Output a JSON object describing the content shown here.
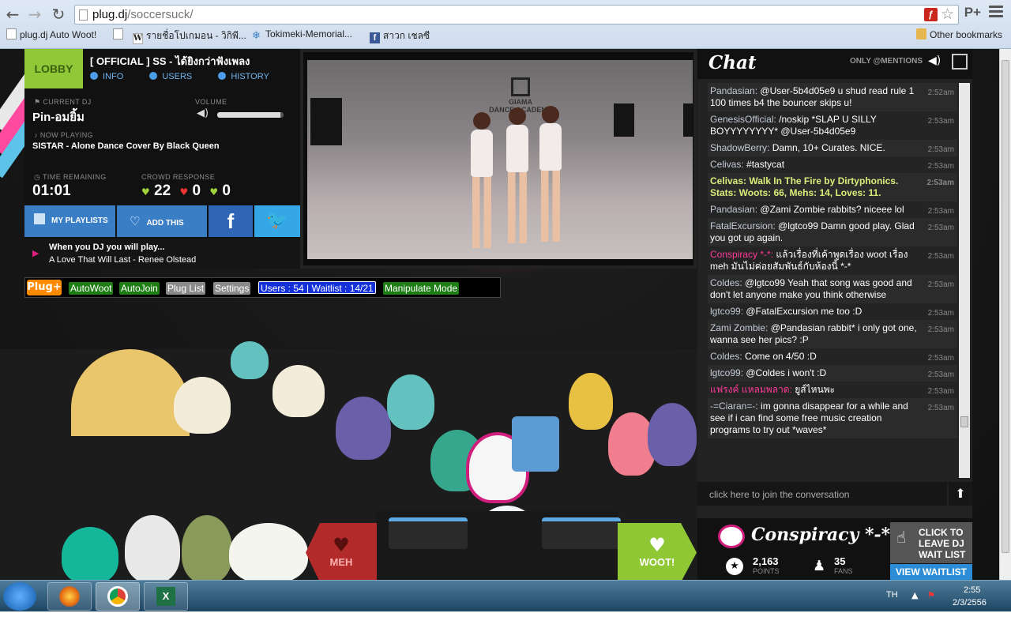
{
  "browser": {
    "url_host": "plug.dj",
    "url_path": "/soccersuck/",
    "bookmarks": [
      {
        "label": "plug.dj Auto Woot!",
        "icon": "page-icon"
      },
      {
        "label": "",
        "icon": "page-icon"
      },
      {
        "label": "รายชื่อโปเกมอน - วิกิพี...",
        "icon": "wikipedia-icon"
      },
      {
        "label": "Tokimeki-Memorial...",
        "icon": "snowflake-icon"
      },
      {
        "label": "สาวก เชลซี",
        "icon": "facebook-icon"
      }
    ],
    "other_bookmarks": "Other bookmarks",
    "profile_label": "P+"
  },
  "room": {
    "lobby_label": "LOBBY",
    "title": "[ OFFICIAL ] SS - ได้ยิงกว่าฟังเพลง",
    "tabs": [
      "INFO",
      "USERS",
      "HISTORY"
    ],
    "current_dj_label": "CURRENT DJ",
    "current_dj": "Pin-อมยิ้ม",
    "volume_label": "VOLUME",
    "volume_level": 0.95,
    "now_playing_label": "NOW PLAYING",
    "now_playing": "SISTAR - Alone Dance Cover By Black Queen",
    "time_remaining_label": "TIME REMAINING",
    "time_remaining": "01:01",
    "crowd_response_label": "CROWD RESPONSE",
    "woots": "22",
    "mehs": "0",
    "curates": "0",
    "my_playlists": "MY PLAYLISTS",
    "add_this": "ADD THIS",
    "facebook": "f",
    "next_label": "When you DJ you will play...",
    "next_song": "A Love That Will Last - Renee Olstead"
  },
  "video": {
    "sign_line1": "GIAMA",
    "sign_line2": "DANCE ACADEMY"
  },
  "plug_plus": {
    "logo": "Plug+",
    "buttons": [
      {
        "label": "AutoWoot",
        "style": "green"
      },
      {
        "label": "AutoJoin",
        "style": "green"
      },
      {
        "label": "Plug List",
        "style": "grey"
      },
      {
        "label": "Settings",
        "style": "grey"
      },
      {
        "label": "Users : 54 | Waitlist : 14/21",
        "style": "blue"
      },
      {
        "label": "Manipulate Mode",
        "style": "green"
      }
    ]
  },
  "chat": {
    "title": "Chat",
    "mentions_label": "ONLY @MENTIONS",
    "messages": [
      {
        "user": "Pandasian:",
        "text": " @User-5b4d05e9 u shud read rule 1 100 times b4 the bouncer skips u!",
        "time": "2:52am",
        "style": ""
      },
      {
        "user": "GenesisOfficial:",
        "text": " /noskip *SLAP U SILLY BOYYYYYYYY* @User-5b4d05e9",
        "time": "2:53am",
        "style": ""
      },
      {
        "user": "ShadowBerry:",
        "text": " Damn, 10+ Curates. NICE.",
        "time": "2:53am",
        "style": ""
      },
      {
        "user": "Celivas:",
        "text": " #tastycat",
        "time": "2:53am",
        "style": ""
      },
      {
        "user": "Celivas:",
        "text": " Walk In The Fire by Dirtyphonics. Stats: Woots: 66, Mehs: 14, Loves: 11.",
        "time": "2:53am",
        "style": "hl"
      },
      {
        "user": "Pandasian:",
        "text": " @Zami Zombie rabbits? niceee lol",
        "time": "2:53am",
        "style": ""
      },
      {
        "user": "FatalExcursion:",
        "text": " @lgtco99 Damn good play. Glad you got up again.",
        "time": "2:53am",
        "style": ""
      },
      {
        "user": "Conspiracy *-*:",
        "text": " แล้วเรื่องที่เค้าพูดเรื่อง woot เรื่อง meh มันไม่ค่อยสัมพันธ์กับห้องนี้ *-*",
        "time": "2:53am",
        "style": "pink"
      },
      {
        "user": "Coldes:",
        "text": " @lgtco99 Yeah that song was good and don't let anyone make you think otherwise",
        "time": "2:53am",
        "style": ""
      },
      {
        "user": "lgtco99:",
        "text": " @FatalExcursion me too :D",
        "time": "2:53am",
        "style": ""
      },
      {
        "user": "Zami Zombie:",
        "text": " @Pandasian rabbit* i only got one, wanna see her pics? :P",
        "time": "2:53am",
        "style": ""
      },
      {
        "user": "Coldes:",
        "text": " Come on 4/50 :D",
        "time": "2:53am",
        "style": ""
      },
      {
        "user": "lgtco99:",
        "text": " @Coldes i won't :D",
        "time": "2:53am",
        "style": ""
      },
      {
        "user": "แฟรงค์ แหลมพลาด:",
        "text": " ยูส์ไหนพะ",
        "time": "2:53am",
        "style": "pink"
      },
      {
        "user": "-=Ciaran=-:",
        "text": " im gonna disappear for a while and see if i can find some free music creation programs to try out *waves*",
        "time": "2:53am",
        "style": ""
      }
    ],
    "input_placeholder": "click here to join the conversation"
  },
  "user": {
    "name": "Conspiracy *-*",
    "points": "2,163",
    "points_label": "POINTS",
    "fans": "35",
    "fans_label": "FANS",
    "waitlist_button": "CLICK TO LEAVE DJ WAIT LIST",
    "view_waitlist": "VIEW WAITLIST"
  },
  "votes": {
    "meh": "MEH",
    "woot": "WOOT!"
  },
  "taskbar": {
    "lang": "TH",
    "time": "2:55",
    "date": "2/3/2556",
    "apps": [
      "firefox-icon",
      "chrome-icon",
      "excel-icon"
    ]
  },
  "colors": {
    "lobby_green": "#90c837",
    "woot_green": "#8fc834",
    "meh_red": "#b32a2a",
    "pink": "#ff3a9a",
    "link_blue": "#3a7ec6"
  }
}
